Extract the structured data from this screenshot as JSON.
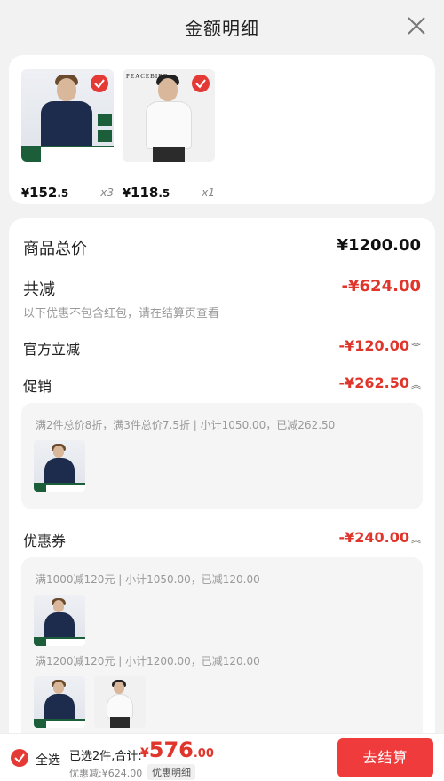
{
  "header": {
    "title": "金额明细"
  },
  "products": [
    {
      "price_cur": "¥",
      "price_int": "152",
      "price_dec": ".5",
      "qty": "x3",
      "brand": ""
    },
    {
      "price_cur": "¥",
      "price_int": "118",
      "price_dec": ".5",
      "qty": "x1",
      "brand": "PEACEBIRD"
    }
  ],
  "summary": {
    "total_label": "商品总价",
    "total_value": "¥1200.00",
    "reduce_label": "共减",
    "reduce_value": "-¥624.00",
    "reduce_note": "以下优惠不包含红包，请在结算页查看",
    "official_label": "官方立减",
    "official_value": "-¥120.00",
    "promo_label": "促销",
    "promo_value": "-¥262.50",
    "promo_desc": "满2件总价8折，满3件总价7.5折 | 小计1050.00，已减262.50",
    "coupon_label": "优惠券",
    "coupon_value": "-¥240.00",
    "coupon_desc_1": "满1000减120元 | 小计1050.00，已减120.00",
    "coupon_desc_2": "满1200减120元 | 小计1200.00，已减120.00"
  },
  "footer": {
    "select_all": "全选",
    "selected_info": "已选2件,合计:",
    "total_cur": "¥",
    "total_int": "576",
    "total_dec": ".00",
    "discount": "优惠减:¥624.00",
    "detail_btn": "优惠明细",
    "pay_btn": "去结算"
  },
  "colors": {
    "accent": "#e0352b",
    "button": "#ef3b3b",
    "check": "#e53935"
  }
}
